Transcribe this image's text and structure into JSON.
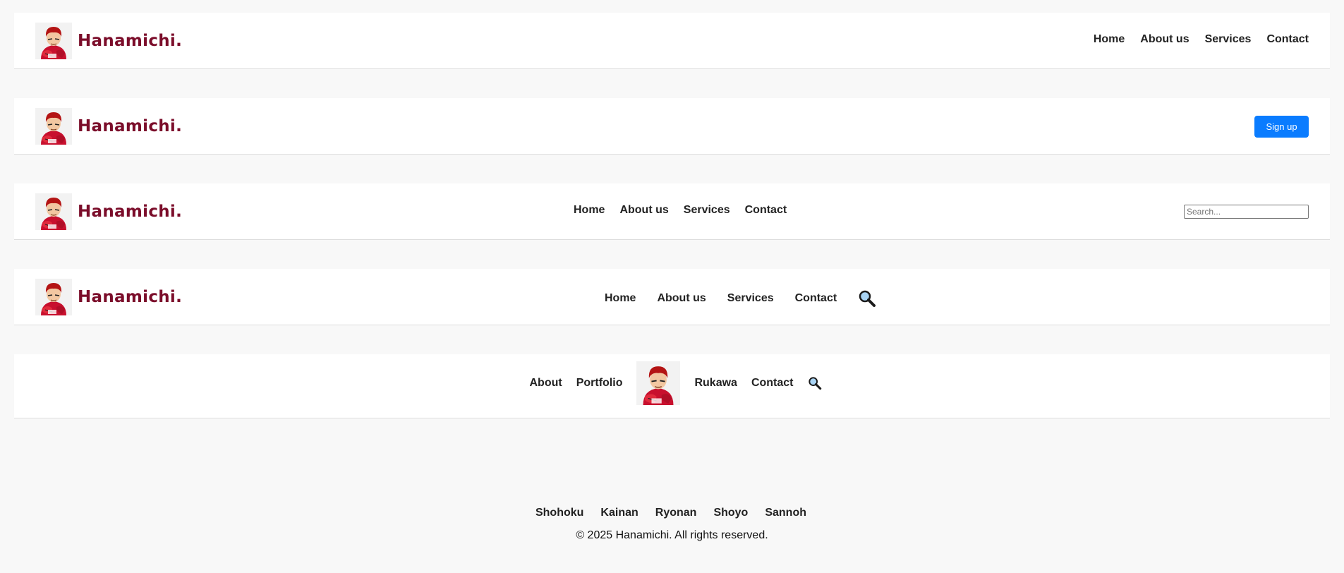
{
  "brand": {
    "name": "Hanamichi."
  },
  "navbar1": {
    "links": [
      "Home",
      "About us",
      "Services",
      "Contact"
    ]
  },
  "navbar2": {
    "signup_label": "Sign up"
  },
  "navbar3": {
    "links": [
      "Home",
      "About us",
      "Services",
      "Contact"
    ],
    "search_placeholder": "Search..."
  },
  "navbar4": {
    "links": [
      "Home",
      "About us",
      "Services",
      "Contact"
    ]
  },
  "navbar5": {
    "left_links": [
      "About",
      "Portfolio"
    ],
    "right_links": [
      "Rukawa",
      "Contact"
    ]
  },
  "footer": {
    "links": [
      "Shohoku",
      "Kainan",
      "Ryonan",
      "Shoyo",
      "Sannoh"
    ],
    "copyright": "© 2025 Hanamichi. All rights reserved."
  },
  "colors": {
    "brand": "#7b0d2a",
    "accent": "#0a7cff",
    "background": "#f8f8f8"
  },
  "icons": {
    "logo": "basketball-player-logo-icon",
    "search": "magnifier-search-icon"
  }
}
